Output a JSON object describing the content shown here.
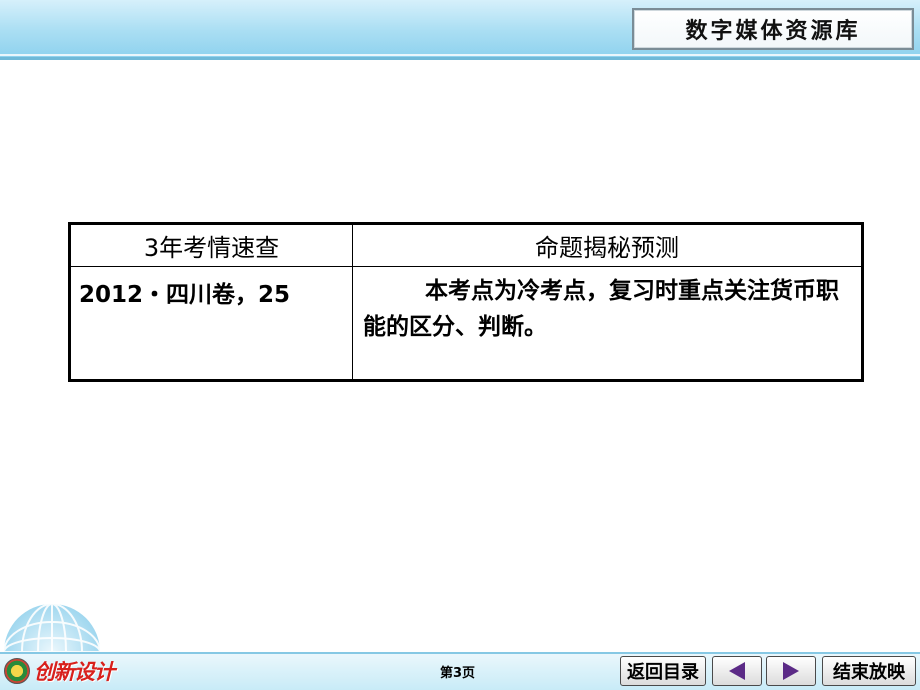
{
  "header": {
    "title": "数字媒体资源库"
  },
  "table": {
    "headers": [
      "3年考情速查",
      "命题揭秘预测"
    ],
    "rows": [
      {
        "year_info": "2012・四川卷，25",
        "prediction": "本考点为冷考点，复习时重点关注货币职能的区分、判断。"
      }
    ]
  },
  "footer": {
    "logo_text": "创新设计",
    "page_label": "第3页",
    "back_label": "返回目录",
    "prev_icon": "left-triangle-icon",
    "next_icon": "right-triangle-icon",
    "end_label": "结束放映"
  },
  "colors": {
    "header_band": "#a9def3",
    "arrow": "#5b2a86",
    "logo_red": "#d8201c"
  }
}
